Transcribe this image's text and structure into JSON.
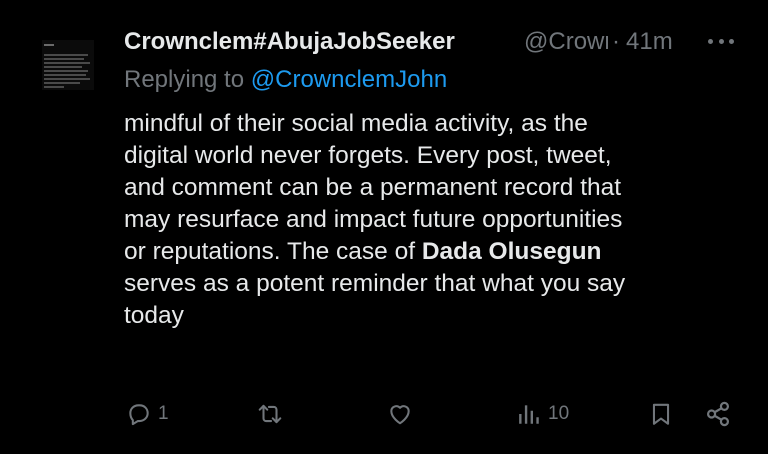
{
  "tweet": {
    "display_name": "Crownclem#AbujaJobSeeker",
    "handle": "@CrownclemJohn",
    "separator": "·",
    "time": "41m",
    "replying_prefix": "Replying to",
    "replying_to": "@CrownclemJohn",
    "body": {
      "line1": "mindful of their social media activity, as the",
      "line2": "digital world never forgets. Every post, tweet,",
      "line3": "and comment can be a permanent record that",
      "line4": "may resurface and impact future opportunities",
      "line5_prefix": "or reputations. The case of ",
      "line5_bold": "Dada Olusegun",
      "line6": "serves as a potent reminder that what you say",
      "line7": "today"
    },
    "actions": {
      "reply_count": "1",
      "repost_count": "",
      "like_count": "",
      "views_count": "10"
    }
  },
  "icons": {
    "reply": "reply-icon",
    "repost": "repost-icon",
    "like": "heart-icon",
    "views": "views-icon",
    "bookmark": "bookmark-icon",
    "share": "share-icon",
    "more": "more-icon"
  },
  "colors": {
    "background": "#000000",
    "text": "#e7e9ea",
    "muted": "#71767b",
    "mention": "#1d9bf0"
  }
}
